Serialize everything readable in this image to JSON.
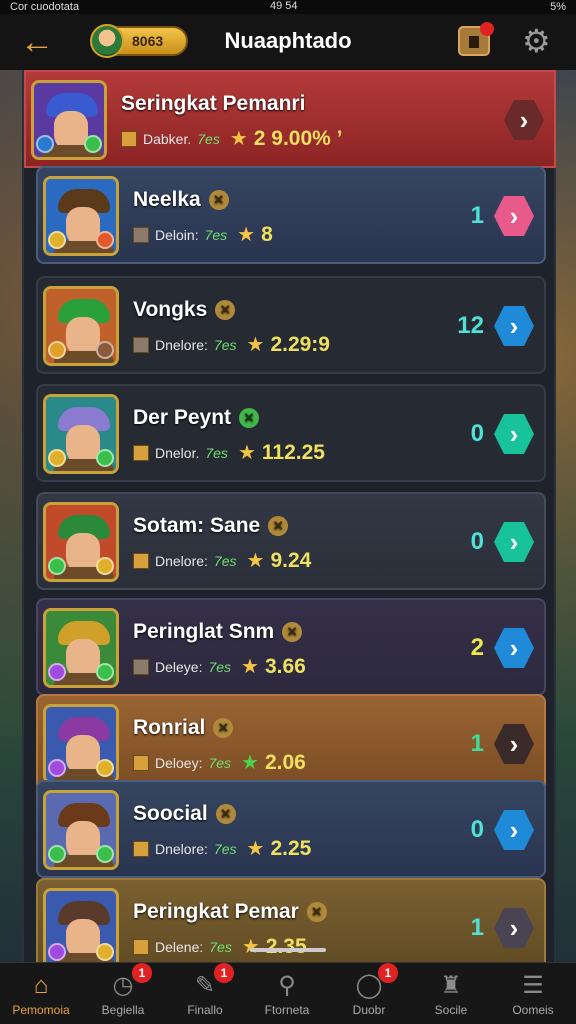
{
  "status": {
    "left": "Cor cuodotata",
    "mid": "49 54",
    "right": "5%"
  },
  "header": {
    "title": "Nuaaphtado",
    "coins": "8063",
    "back_icon": "arrow-left-icon",
    "mail_icon": "mail-icon",
    "settings_icon": "gear-icon"
  },
  "colors": {
    "accent": "#e6a23c",
    "panel": "#1d222b"
  },
  "rows": [
    {
      "name": "Seringkat Pemanri",
      "badge": "",
      "d_label": "Dabker.",
      "d_val": "7es",
      "score": "2 9.00% ’",
      "count": "",
      "theme": "red",
      "go": "maroon"
    },
    {
      "name": "Neelka",
      "badge": "✕",
      "d_label": "Deloin:",
      "d_val": "7es",
      "score": "8",
      "count": "1",
      "theme": "blue",
      "go": "pink"
    },
    {
      "name": "Vongks",
      "badge": "✕",
      "d_label": "Dnelore:",
      "d_val": "7es",
      "score": "2.29:9",
      "count": "12",
      "theme": "dark",
      "go": "blue"
    },
    {
      "name": "Der Peynt",
      "badge": "✕",
      "d_label": "Dnelor.",
      "d_val": "7es",
      "score": "112.25",
      "count": "0",
      "theme": "dark",
      "go": "teal"
    },
    {
      "name": "Sotam: Sane",
      "badge": "✕",
      "d_label": "Dnelore:",
      "d_val": "7es",
      "score": "9.24",
      "count": "0",
      "theme": "gray",
      "go": "teal"
    },
    {
      "name": "Peringlat Snm",
      "badge": "✕",
      "d_label": "Deleye:",
      "d_val": "7es",
      "score": "3.66",
      "count": "2",
      "theme": "purple",
      "go": "blue"
    },
    {
      "name": "Ronrial",
      "badge": "✕",
      "d_label": "Deloey:",
      "d_val": "7es",
      "score": "2.06",
      "count": "1",
      "theme": "orange",
      "go": "dark"
    },
    {
      "name": "Soocial",
      "badge": "✕",
      "d_label": "Dnelore:",
      "d_val": "7es",
      "score": "2.25",
      "count": "0",
      "theme": "blue",
      "go": "blue"
    },
    {
      "name": "Peringkat Pemar",
      "badge": "✕",
      "d_label": "Delene:",
      "d_val": "7es",
      "score": "2.35",
      "count": "1",
      "theme": "gold",
      "go": "gray"
    }
  ],
  "nav": [
    {
      "label": "Pemomoia",
      "icon": "home-icon",
      "badge": ""
    },
    {
      "label": "Begiella",
      "icon": "clock-icon",
      "badge": "1"
    },
    {
      "label": "Finallo",
      "icon": "ticket-icon",
      "badge": "1"
    },
    {
      "label": "Ftorneta",
      "icon": "search-icon",
      "badge": ""
    },
    {
      "label": "Duobr",
      "icon": "chat-icon",
      "badge": "1"
    },
    {
      "label": "Socile",
      "icon": "trophy-icon",
      "badge": ""
    },
    {
      "label": "Oomeis",
      "icon": "menu-icon",
      "badge": ""
    }
  ]
}
